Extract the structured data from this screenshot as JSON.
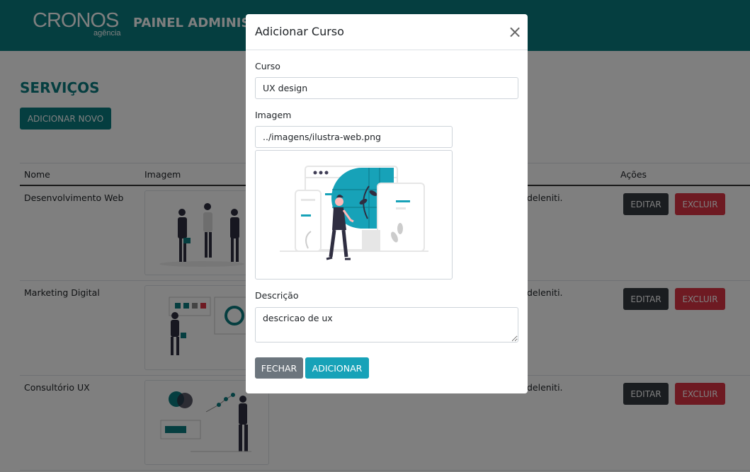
{
  "header": {
    "logo_main": "CRONOS",
    "logo_sub": "agência",
    "panel_title": "PAINEL ADMINISTRATIVO"
  },
  "page": {
    "title": "SERVIÇOS",
    "add_new_label": "ADICIONAR NOVO"
  },
  "table": {
    "columns": [
      "Nome",
      "Imagem",
      "Ações"
    ],
    "rows": [
      {
        "name": "Desenvolvimento Web",
        "desc": "deleniti."
      },
      {
        "name": "Marketing Digital",
        "desc": "deleniti."
      },
      {
        "name": "Consultório UX",
        "desc": "deleniti."
      }
    ],
    "edit_label": "EDITAR",
    "delete_label": "EXCLUIR"
  },
  "modal": {
    "title": "Adicionar Curso",
    "close_icon": "close-icon",
    "course_label": "Curso",
    "course_value": "UX design",
    "image_label": "Imagem",
    "image_value": "../imagens/ilustra-web.png",
    "description_label": "Descrição",
    "description_value": "descricao de ux",
    "close_label": "FECHAR",
    "add_label": "ADICIONAR"
  },
  "colors": {
    "brand": "#0b7d81",
    "accent": "#17a2b8",
    "danger": "#dc3545",
    "dark": "#343a40",
    "secondary": "#6c757d"
  }
}
